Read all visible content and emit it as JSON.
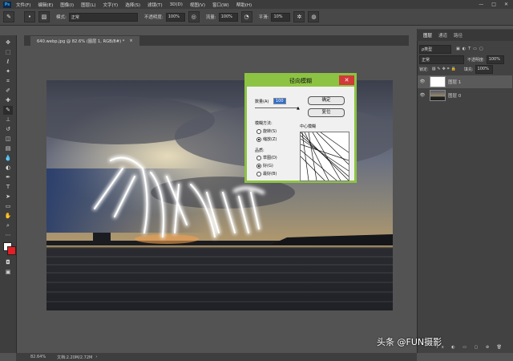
{
  "menubar": {
    "logo": "Ps",
    "items": [
      "文件(F)",
      "编辑(E)",
      "图像(I)",
      "图层(L)",
      "文字(Y)",
      "选择(S)",
      "滤镜(T)",
      "3D(D)",
      "视图(V)",
      "窗口(W)",
      "帮助(H)"
    ],
    "window_controls": [
      "—",
      "□",
      "✕"
    ]
  },
  "options": {
    "mode_label": "模式:",
    "mode_value": "正常",
    "opacity_label": "不透明度:",
    "opacity_value": "100%",
    "flow_label": "流量:",
    "flow_value": "100%",
    "smooth_label": "平滑:",
    "smooth_value": "10%"
  },
  "document": {
    "tab_title": "640.webp.jpg @ 82.6% (图层 1, RGB/8#) *",
    "tab_close": "×"
  },
  "status": {
    "zoom": "82.64%",
    "doc_info": "文档:2.20M/2.72M"
  },
  "panel": {
    "tabs": [
      "图层",
      "通道",
      "路径"
    ],
    "filter_label": "ρ类型",
    "blend_mode": "正常",
    "opacity_label": "不透明度:",
    "opacity_value": "100%",
    "lock_label": "锁定:",
    "fill_label": "填充:",
    "fill_value": "100%",
    "layers": [
      {
        "name": "图层 1"
      },
      {
        "name": "图层 0"
      }
    ],
    "bottom_icons": "fx ◐ ▭ ▢ ⊕ 🗑"
  },
  "dialog": {
    "title": "径向模糊",
    "close": "✕",
    "amount_label": "数量(A)",
    "amount_value": "100",
    "ok_label": "确定",
    "cancel_label": "复位",
    "blur_method_label": "模糊方法:",
    "method_spin": "旋转(S)",
    "method_zoom": "缩放(Z)",
    "quality_label": "品质:",
    "quality_draft": "草图(D)",
    "quality_good": "好(G)",
    "quality_best": "最好(B)",
    "center_label": "中心模糊"
  },
  "watermark": "头条 @FUN摄影"
}
